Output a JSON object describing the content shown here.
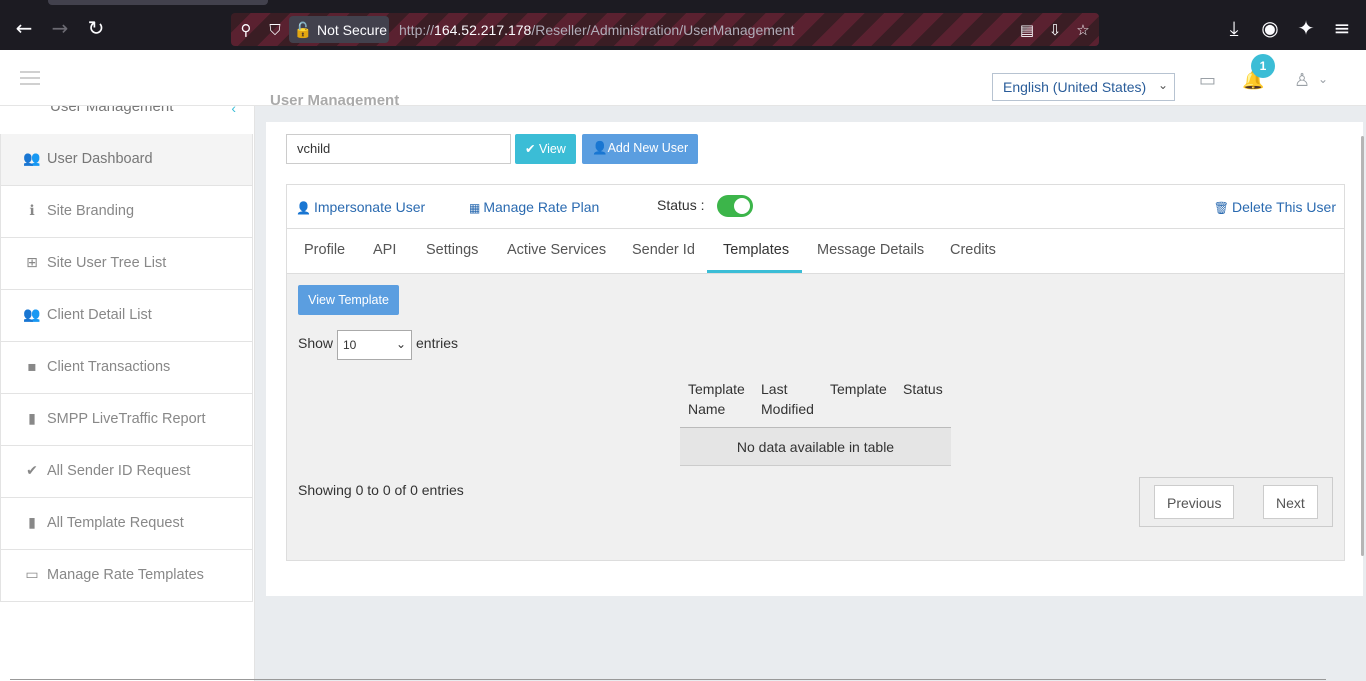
{
  "browser": {
    "security_label": "Not Secure",
    "url_prefix": "http://",
    "url_host": "164.52.217.178",
    "url_path": "/Reseller/Administration/UserManagement"
  },
  "header": {
    "language": "English (United States)",
    "notification_count": "1"
  },
  "sidebar": {
    "section_title": "User Management",
    "items": [
      {
        "label": "User Dashboard",
        "icon": "users-icon",
        "glyph": "👥"
      },
      {
        "label": "Site Branding",
        "icon": "info-icon",
        "glyph": "ℹ"
      },
      {
        "label": "Site User Tree List",
        "icon": "sitemap-icon",
        "glyph": "⊞"
      },
      {
        "label": "Client Detail List",
        "icon": "users-icon",
        "glyph": "👥"
      },
      {
        "label": "Client Transactions",
        "icon": "sticky-note-icon",
        "glyph": "▪"
      },
      {
        "label": "SMPP LiveTraffic Report",
        "icon": "file-icon",
        "glyph": "▮"
      },
      {
        "label": "All Sender ID Request",
        "icon": "check-circle-icon",
        "glyph": "✔"
      },
      {
        "label": "All Template Request",
        "icon": "file-icon",
        "glyph": "▮"
      },
      {
        "label": "Manage Rate Templates",
        "icon": "money-icon",
        "glyph": "▭"
      }
    ]
  },
  "main": {
    "page_title": "User Management",
    "user_input_value": "vchild",
    "view_button": "View",
    "add_user_button": "Add New User",
    "impersonate_link": "Impersonate User",
    "rate_plan_link": "Manage Rate Plan",
    "status_label": "Status :",
    "delete_link": "Delete This User",
    "tabs": [
      "Profile",
      "API",
      "Settings",
      "Active Services",
      "Sender Id",
      "Templates",
      "Message Details",
      "Credits"
    ],
    "active_tab": "Templates",
    "view_template_button": "View Template",
    "show_label": "Show",
    "entries_value": "10",
    "entries_label": "entries",
    "table_headers": [
      "Template Name",
      "Last Modified",
      "Template",
      "Status"
    ],
    "empty_message": "No data available in table",
    "showing_text": "Showing 0 to 0 of 0 entries",
    "prev_button": "Previous",
    "next_button": "Next"
  },
  "colors": {
    "accent": "#3bbdd6",
    "primary_button": "#5b9ee0",
    "toggle_on": "#3cb54a",
    "link": "#2a6ab0"
  }
}
